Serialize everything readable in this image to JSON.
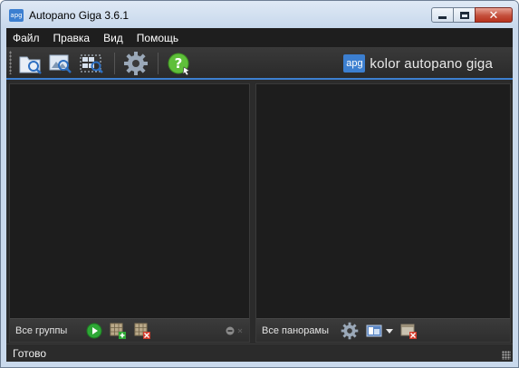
{
  "window": {
    "title": "Autopano Giga 3.6.1",
    "app_icon_text": "apg"
  },
  "menu": {
    "items": [
      "Файл",
      "Правка",
      "Вид",
      "Помощь"
    ]
  },
  "toolbar": {
    "buttons": [
      "open-folder-icon",
      "import-images-icon",
      "detect-icon",
      "settings-gear-icon",
      "help-icon"
    ],
    "brand_logo_text": "apg",
    "brand_text": "kolor autopano giga",
    "accent_color": "#3c7fd0"
  },
  "groups_panel": {
    "footer_label": "Все группы",
    "icons": [
      "play-icon",
      "add-group-icon",
      "remove-group-icon",
      "collapse-icon"
    ]
  },
  "panoramas_panel": {
    "footer_label": "Все панорамы",
    "icons": [
      "settings-gear-icon",
      "render-icon",
      "dropdown-arrow-icon",
      "remove-panorama-icon"
    ]
  },
  "status": {
    "text": "Готово"
  }
}
